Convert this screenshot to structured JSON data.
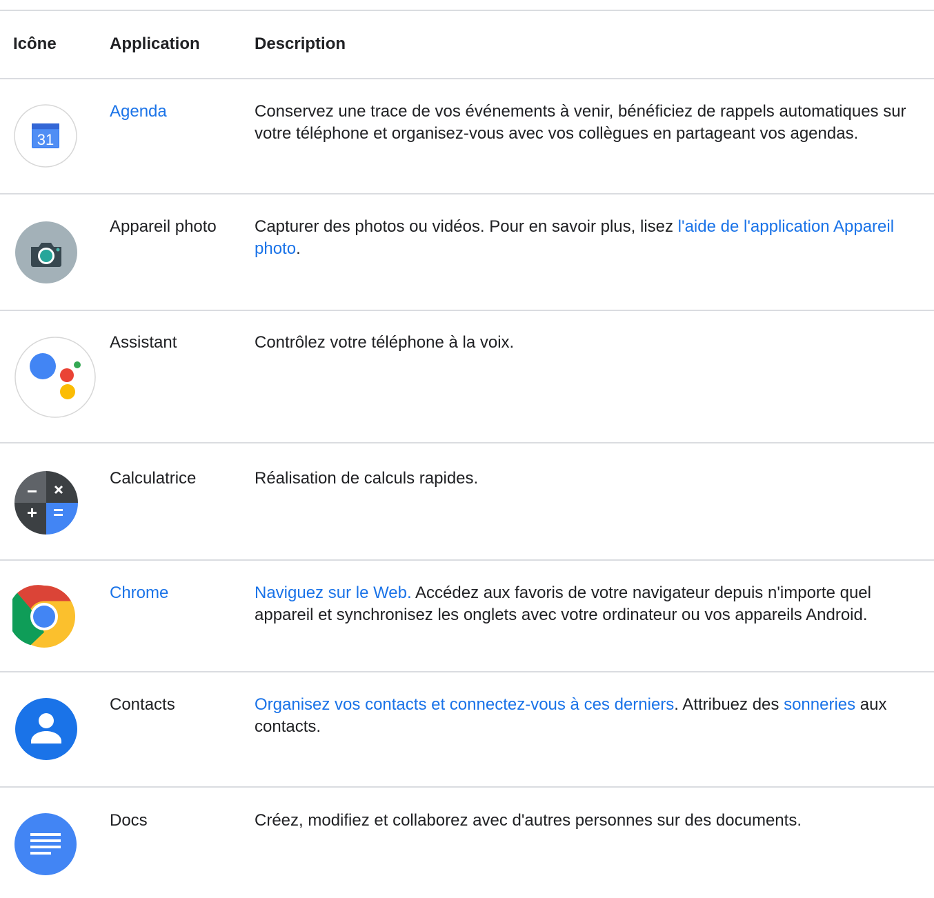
{
  "header": {
    "icon_col": "Icône",
    "app_col": "Application",
    "desc_col": "Description"
  },
  "rows": [
    {
      "icon": "calendar-icon",
      "icon_text": "31",
      "app": "Agenda",
      "app_is_link": true,
      "desc": "Conservez une trace de vos événements à venir, bénéficiez de rappels automatiques sur votre téléphone et organisez-vous avec vos collègues en partageant vos agendas."
    },
    {
      "icon": "camera-icon",
      "app": "Appareil photo",
      "app_is_link": false,
      "desc_before": "Capturer des photos ou vidéos. Pour en savoir plus, lisez ",
      "desc_link": "l'aide de l'application Appareil photo",
      "desc_after": "."
    },
    {
      "icon": "assistant-icon",
      "app": "Assistant",
      "app_is_link": false,
      "desc": "Contrôlez votre téléphone à la voix."
    },
    {
      "icon": "calculator-icon",
      "app": "Calculatrice",
      "app_is_link": false,
      "desc": "Réalisation de calculs rapides."
    },
    {
      "icon": "chrome-icon",
      "app": "Chrome",
      "app_is_link": true,
      "desc_link": "Naviguez sur le Web.",
      "desc_after": " Accédez aux favoris de votre navigateur depuis n'importe quel appareil et synchronisez les onglets avec votre ordinateur ou vos appareils Android."
    },
    {
      "icon": "contacts-icon",
      "app": "Contacts",
      "app_is_link": false,
      "desc_link": "Organisez vos contacts et connectez-vous à ces derniers",
      "desc_middle": ". Attribuez des ",
      "desc_link2": "sonneries",
      "desc_after": " aux contacts."
    },
    {
      "icon": "docs-icon",
      "app": "Docs",
      "app_is_link": false,
      "desc": "Créez, modifiez et collaborez avec d'autres personnes sur des documents."
    }
  ],
  "colors": {
    "link": "#1a73e8",
    "text": "#202124",
    "divider": "#dadce0"
  }
}
